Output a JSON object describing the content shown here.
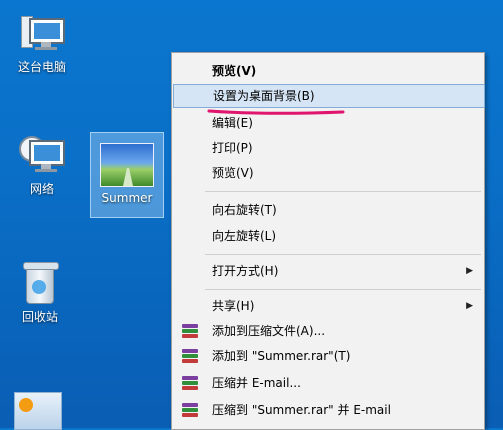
{
  "desktop": {
    "icons": [
      {
        "label": "这台电脑",
        "icon": "this-pc-icon"
      },
      {
        "label": "网络",
        "icon": "network-icon"
      },
      {
        "label": "Summer",
        "icon": "image-file-icon"
      },
      {
        "label": "回收站",
        "icon": "recycle-bin-icon"
      }
    ]
  },
  "context_menu": {
    "items": [
      {
        "label": "预览(V)",
        "bold": true
      },
      {
        "label": "设置为桌面背景(B)",
        "highlighted": true
      },
      {
        "label": "编辑(E)"
      },
      {
        "label": "打印(P)"
      },
      {
        "label": "预览(V)"
      },
      {
        "label": "向右旋转(T)"
      },
      {
        "label": "向左旋转(L)"
      },
      {
        "label": "打开方式(H)",
        "submenu": true
      },
      {
        "label": "共享(H)",
        "submenu": true
      },
      {
        "label": "添加到压缩文件(A)...",
        "icon": "winrar-icon"
      },
      {
        "label": "添加到 \"Summer.rar\"(T)",
        "icon": "winrar-icon"
      },
      {
        "label": "压缩并 E-mail...",
        "icon": "winrar-icon"
      },
      {
        "label": "压缩到 \"Summer.rar\" 并 E-mail",
        "icon": "winrar-icon"
      }
    ],
    "annotation_color": "#e0156e",
    "highlight_color": "#d5e5f5"
  }
}
